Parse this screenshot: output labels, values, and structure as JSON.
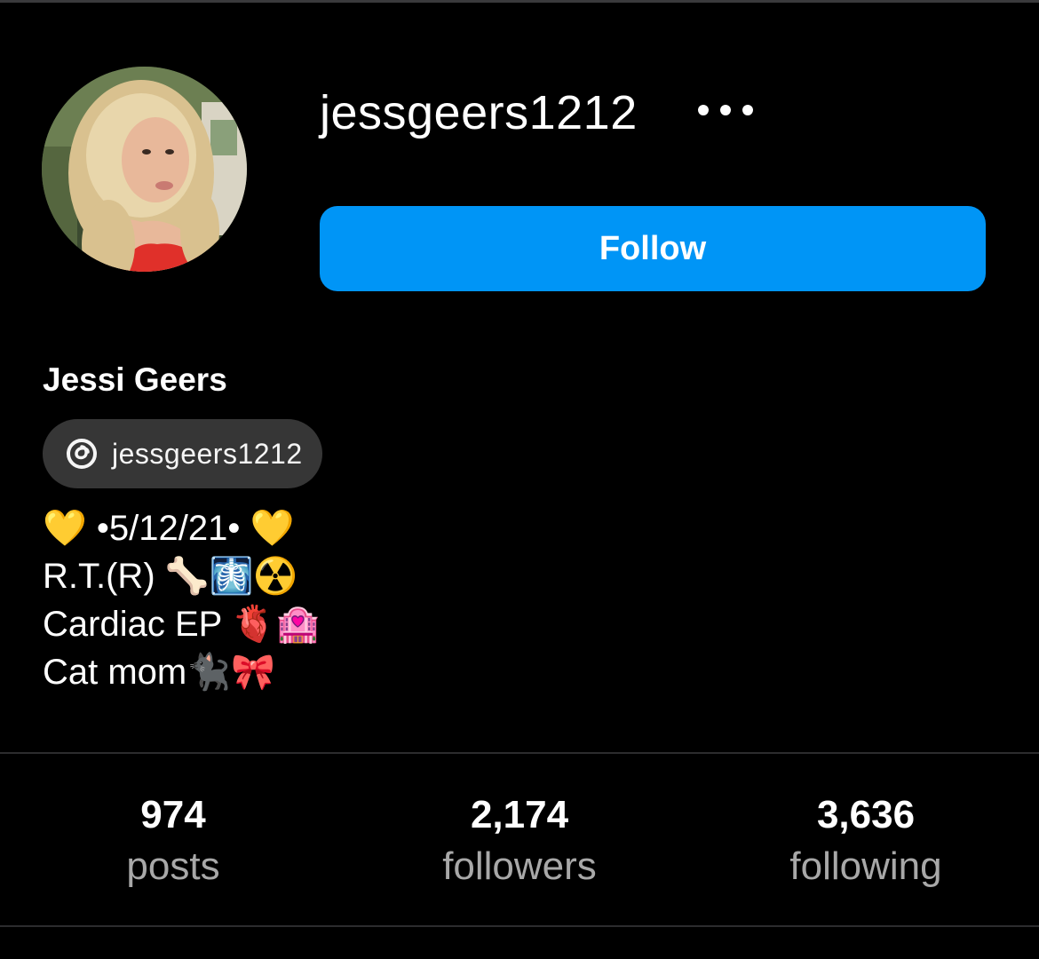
{
  "profile": {
    "username": "jessgeers1212",
    "display_name": "Jessi Geers",
    "follow_label": "Follow",
    "threads_handle": "jessgeers1212",
    "bio_lines": [
      "💛 •5/12/21• 💛",
      "R.T.(R) 🦴🩻☢️",
      "Cardiac EP 🫀🏩",
      "Cat mom🐈‍⬛🎀"
    ]
  },
  "stats": {
    "posts": {
      "count": "974",
      "label": "posts"
    },
    "followers": {
      "count": "2,174",
      "label": "followers"
    },
    "following": {
      "count": "3,636",
      "label": "following"
    }
  },
  "icons": {
    "more": "more-horizontal-icon",
    "threads": "threads-icon"
  },
  "colors": {
    "background": "#000000",
    "follow_button": "#0095f6",
    "chip_background": "#363636",
    "secondary_text": "#a8a8a8"
  }
}
